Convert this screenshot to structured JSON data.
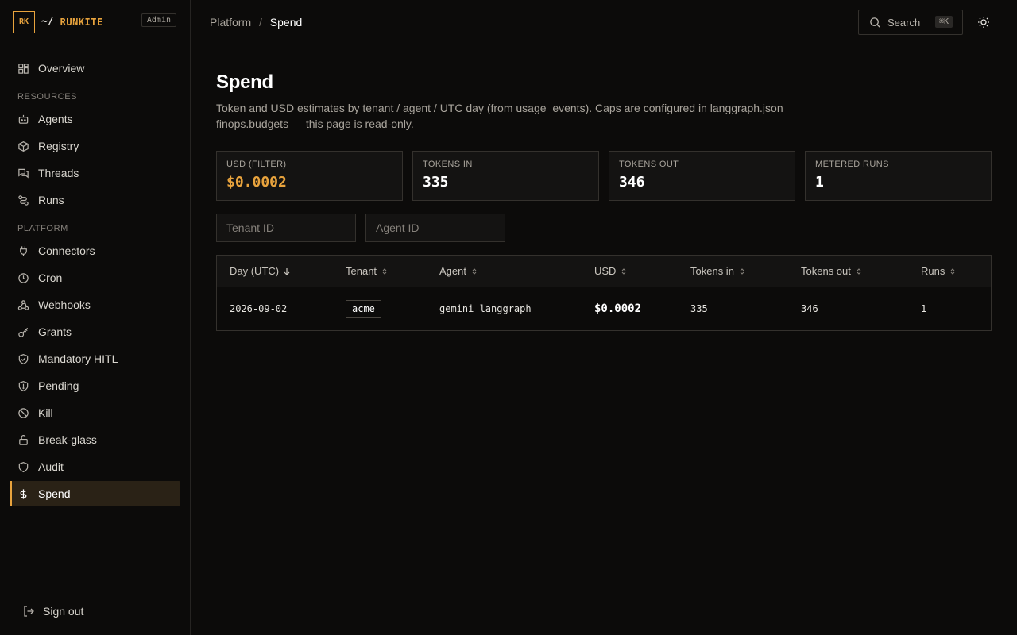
{
  "brand": {
    "logo": "RK",
    "tilde": "~/",
    "name": "RUNKITE",
    "badge": "Admin"
  },
  "sidebar": {
    "overview": "Overview",
    "sections": [
      {
        "title": "RESOURCES",
        "items": [
          "Agents",
          "Registry",
          "Threads",
          "Runs"
        ]
      },
      {
        "title": "PLATFORM",
        "items": [
          "Connectors",
          "Cron",
          "Webhooks",
          "Grants",
          "Mandatory HITL",
          "Pending",
          "Kill",
          "Break-glass",
          "Audit",
          "Spend"
        ]
      }
    ],
    "active": "Spend",
    "signout": "Sign out"
  },
  "topbar": {
    "breadcrumb_parent": "Platform",
    "breadcrumb_sep": "/",
    "breadcrumb_current": "Spend",
    "search_label": "Search",
    "search_kbd": "⌘K"
  },
  "page": {
    "title": "Spend",
    "description": "Token and USD estimates by tenant / agent / UTC day (from usage_events). Caps are configured in langgraph.json finops.budgets — this page is read-only."
  },
  "stats": [
    {
      "label": "USD (FILTER)",
      "value": "$0.0002"
    },
    {
      "label": "TOKENS IN",
      "value": "335"
    },
    {
      "label": "TOKENS OUT",
      "value": "346"
    },
    {
      "label": "METERED RUNS",
      "value": "1"
    }
  ],
  "filters": {
    "tenant_placeholder": "Tenant ID",
    "agent_placeholder": "Agent ID"
  },
  "table": {
    "headers": [
      "Day (UTC)",
      "Tenant",
      "Agent",
      "USD",
      "Tokens in",
      "Tokens out",
      "Runs"
    ],
    "rows": [
      {
        "day": "2026-09-02",
        "tenant": "acme",
        "agent": "gemini_langgraph",
        "usd": "$0.0002",
        "tokens_in": "335",
        "tokens_out": "346",
        "runs": "1"
      }
    ]
  },
  "colors": {
    "accent": "#e8a33d",
    "background": "#0c0b0a",
    "border": "#34312d"
  }
}
